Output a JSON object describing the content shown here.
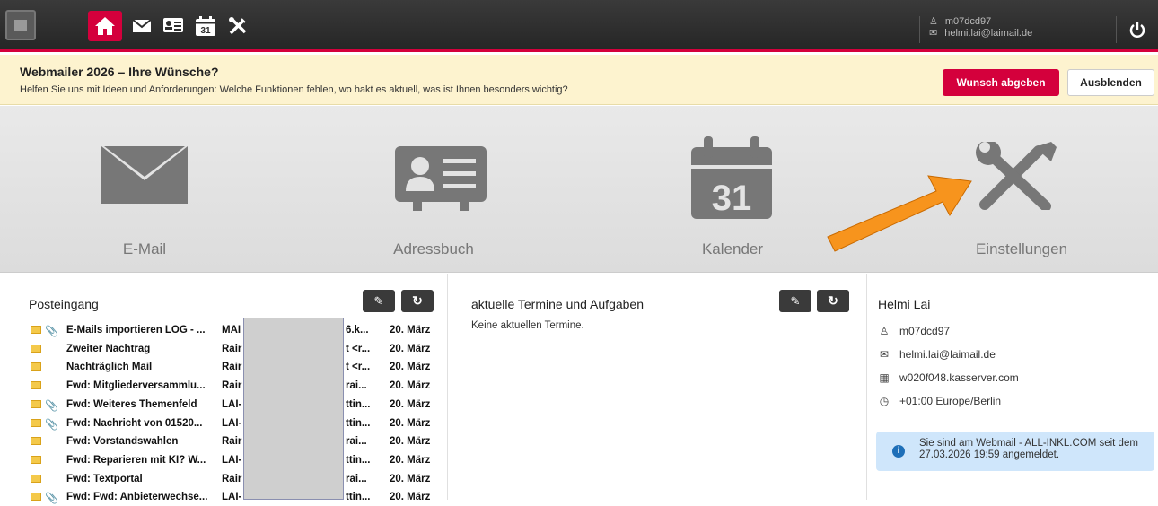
{
  "topbar": {
    "nav": [
      "home-icon",
      "mail-icon",
      "addressbook-icon",
      "calendar-icon",
      "tools-icon"
    ],
    "calendar_day": "31",
    "user": {
      "login": "m07dcd97",
      "email": "helmi.lai@laimail.de"
    },
    "accent_color": "#d4003c"
  },
  "banner": {
    "title": "Webmailer 2026 – Ihre Wünsche?",
    "text": "Helfen Sie uns mit Ideen und Anforderungen: Welche Funktionen fehlen, wo hakt es aktuell, was ist Ihnen besonders wichtig?",
    "primary_button": "Wunsch abgeben",
    "secondary_button": "Ausblenden"
  },
  "tiles": [
    {
      "label": "E-Mail",
      "icon": "mail-icon"
    },
    {
      "label": "Adressbuch",
      "icon": "addressbook-icon"
    },
    {
      "label": "Kalender",
      "icon": "calendar-icon",
      "day": "31"
    },
    {
      "label": "Einstellungen",
      "icon": "tools-icon"
    }
  ],
  "inbox": {
    "title": "Posteingang",
    "rows": [
      {
        "subject": "E-Mails importieren LOG - ...",
        "from": "MAI",
        "extra": "6.k...",
        "date": "20. März",
        "attach": true
      },
      {
        "subject": "Zweiter Nachtrag",
        "from": "Rair",
        "extra": "t <r...",
        "date": "20. März",
        "attach": false
      },
      {
        "subject": "Nachträglich Mail",
        "from": "Rair",
        "extra": "t <r...",
        "date": "20. März",
        "attach": false
      },
      {
        "subject": "Fwd: Mitgliederversammlu...",
        "from": "Rair",
        "extra": "rai...",
        "date": "20. März",
        "attach": false
      },
      {
        "subject": "Fwd: Weiteres Themenfeld",
        "from": "LAI-",
        "extra": "ttin...",
        "date": "20. März",
        "attach": true
      },
      {
        "subject": "Fwd: Nachricht von 01520...",
        "from": "LAI-",
        "extra": "ttin...",
        "date": "20. März",
        "attach": true
      },
      {
        "subject": "Fwd: Vorstandswahlen",
        "from": "Rair",
        "extra": "rai...",
        "date": "20. März",
        "attach": false
      },
      {
        "subject": "Fwd: Reparieren mit KI? W...",
        "from": "LAI-",
        "extra": "ttin...",
        "date": "20. März",
        "attach": false
      },
      {
        "subject": "Fwd: Textportal",
        "from": "Rair",
        "extra": "rai...",
        "date": "20. März",
        "attach": false
      },
      {
        "subject": "Fwd: Fwd: Anbieterwechse...",
        "from": "LAI-",
        "extra": "ttin...",
        "date": "20. März",
        "attach": true
      }
    ]
  },
  "appointments": {
    "title": "aktuelle Termine und Aufgaben",
    "empty": "Keine aktuellen Termine."
  },
  "account": {
    "name": "Helmi Lai",
    "login": "m07dcd97",
    "email": "helmi.lai@laimail.de",
    "server": "w020f048.kasserver.com",
    "timezone": "+01:00 Europe/Berlin",
    "notice": "Sie sind am Webmail - ALL-INKL.COM seit dem 27.03.2026 19:59 angemeldet."
  },
  "annotation_color": "#f7941d"
}
